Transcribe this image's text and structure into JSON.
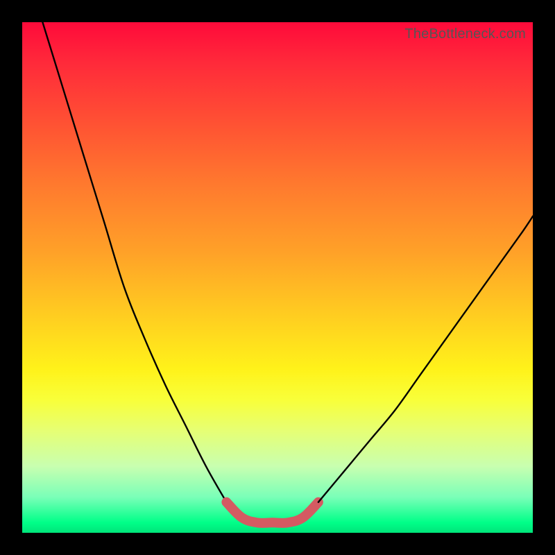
{
  "watermark": "TheBottleneck.com",
  "chart_data": {
    "type": "line",
    "title": "",
    "xlabel": "",
    "ylabel": "",
    "xlim": [
      0,
      100
    ],
    "ylim": [
      0,
      100
    ],
    "grid": false,
    "series": [
      {
        "name": "black-curve-left",
        "color": "#000000",
        "x": [
          4,
          8,
          12,
          16,
          20,
          24,
          28,
          32,
          36,
          40
        ],
        "y": [
          100,
          87,
          74,
          61,
          48,
          38,
          29,
          21,
          13,
          6
        ]
      },
      {
        "name": "red-flat-segment",
        "color": "#d45a62",
        "x": [
          40,
          43,
          46,
          49,
          52,
          55,
          58
        ],
        "y": [
          6,
          3,
          2,
          2,
          2,
          3,
          6
        ]
      },
      {
        "name": "black-curve-right",
        "color": "#000000",
        "x": [
          58,
          63,
          68,
          73,
          78,
          83,
          88,
          93,
          98,
          100
        ],
        "y": [
          6,
          12,
          18,
          24,
          31,
          38,
          45,
          52,
          59,
          62
        ]
      }
    ],
    "annotations": []
  }
}
